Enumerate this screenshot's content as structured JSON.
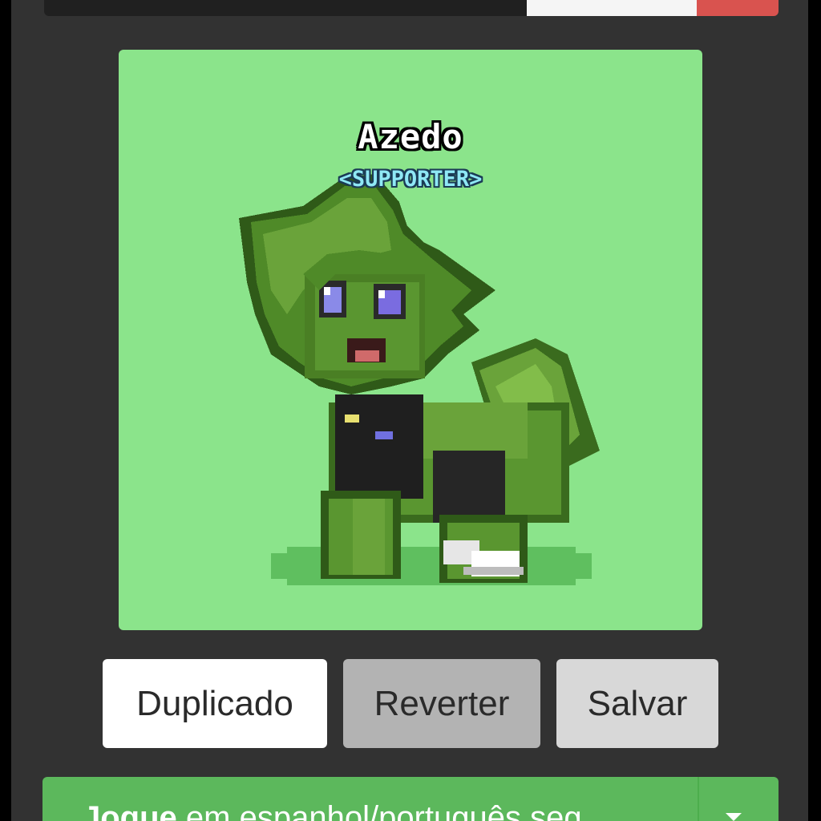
{
  "preview": {
    "pony_name": "Azedo",
    "pony_tag": "<SUPPORTER>",
    "background_color": "#8be48b"
  },
  "actions": {
    "duplicate_label": "Duplicado",
    "revert_label": "Reverter",
    "save_label": "Salvar"
  },
  "language_bar": {
    "bold_label": "Jogue",
    "text": " em espanhol/português seg",
    "dropdown_icon": "caret-down-icon",
    "color": "#5cb85c"
  },
  "top_bar": {
    "accent_color": "#d9534f"
  }
}
